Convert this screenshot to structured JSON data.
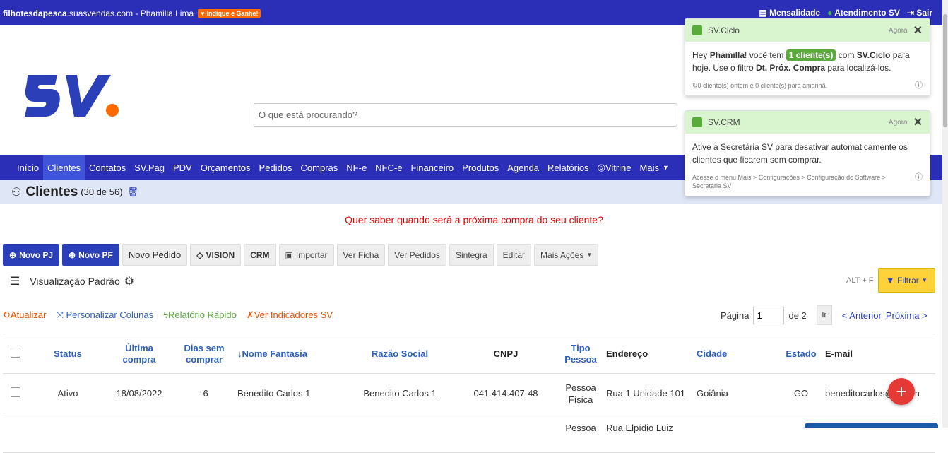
{
  "topbar": {
    "domain_bold": "filhotesdapesca",
    "domain_rest": ".suasvendas.com - Phamilla Lima",
    "indique": "Indique e Ganhe!",
    "mensalidade": "Mensalidade",
    "atendimento": "Atendimento SV",
    "sair": "Sair"
  },
  "search": {
    "placeholder": "O que está procurando?"
  },
  "nav": [
    "Início",
    "Clientes",
    "Contatos",
    "SV.Pag",
    "PDV",
    "Orçamentos",
    "Pedidos",
    "Compras",
    "NF-e",
    "NFC-e",
    "Financeiro",
    "Produtos",
    "Agenda",
    "Relatórios",
    "Vitrine",
    "Mais"
  ],
  "page": {
    "title": "Clientes",
    "count": "(30 de 56)"
  },
  "promo": "Quer saber quando será a próxima compra do seu cliente?",
  "buttons": [
    "Novo PJ",
    "Novo PF",
    "Novo Pedido",
    "VISION",
    "CRM",
    "Importar",
    "Ver Ficha",
    "Ver Pedidos",
    "Sintegra",
    "Editar",
    "Mais Ações"
  ],
  "view": {
    "label": "Visualização Padrão",
    "shortcut": "ALT + F",
    "filter": "Filtrar"
  },
  "links": [
    "Atualizar",
    "Personalizar Colunas",
    "Relatório Rápido",
    "Ver Indicadores SV"
  ],
  "pager": {
    "label": "Página",
    "value": "1",
    "of": "de 2",
    "go": "Ir",
    "prev": "< Anterior",
    "next": "Próxima >"
  },
  "table": {
    "headers": [
      "Status",
      "Última compra",
      "Dias sem comprar",
      "↓Nome Fantasia",
      "Razão Social",
      "CNPJ",
      "Tipo Pessoa",
      "Endereço",
      "Cidade",
      "Estado",
      "E-mail"
    ],
    "rows": [
      [
        "Ativo",
        "18/08/2022",
        "-6",
        "Benedito Carlos 1",
        "Benedito Carlos 1",
        "041.414.407-48",
        "Pessoa Física",
        "Rua 1 Unidade 101",
        "Goiânia",
        "GO",
        "beneditocarlos@g...om"
      ]
    ],
    "partial": [
      "Pessoa",
      "Rua Elpídio Luiz"
    ]
  },
  "toasts": [
    {
      "title": "SV.Ciclo",
      "time": "Agora",
      "pre": "Hey ",
      "name": "Phamilla",
      "mid": "! você tem ",
      "pill": "1 cliente(s)",
      "mid2": " com ",
      "brand": "SV.Ciclo",
      "post": " para hoje. Use o filtro ",
      "filter": "Dt. Próx. Compra",
      "end": " para localizá-los.",
      "footer": "0 cliente(s) ontem e 0 cliente(s) para amanhã."
    },
    {
      "title": "SV.CRM",
      "time": "Agora",
      "body": "Ative a Secretária SV para desativar automaticamente os clientes que ficarem sem comprar.",
      "footer": "Acesse o menu Mais > Configurações > Configuração do Software > Secretária SV"
    }
  ],
  "colors": {
    "brand": "#2b2fb8",
    "accent": "#ff6a00",
    "success": "#5aab3c"
  }
}
